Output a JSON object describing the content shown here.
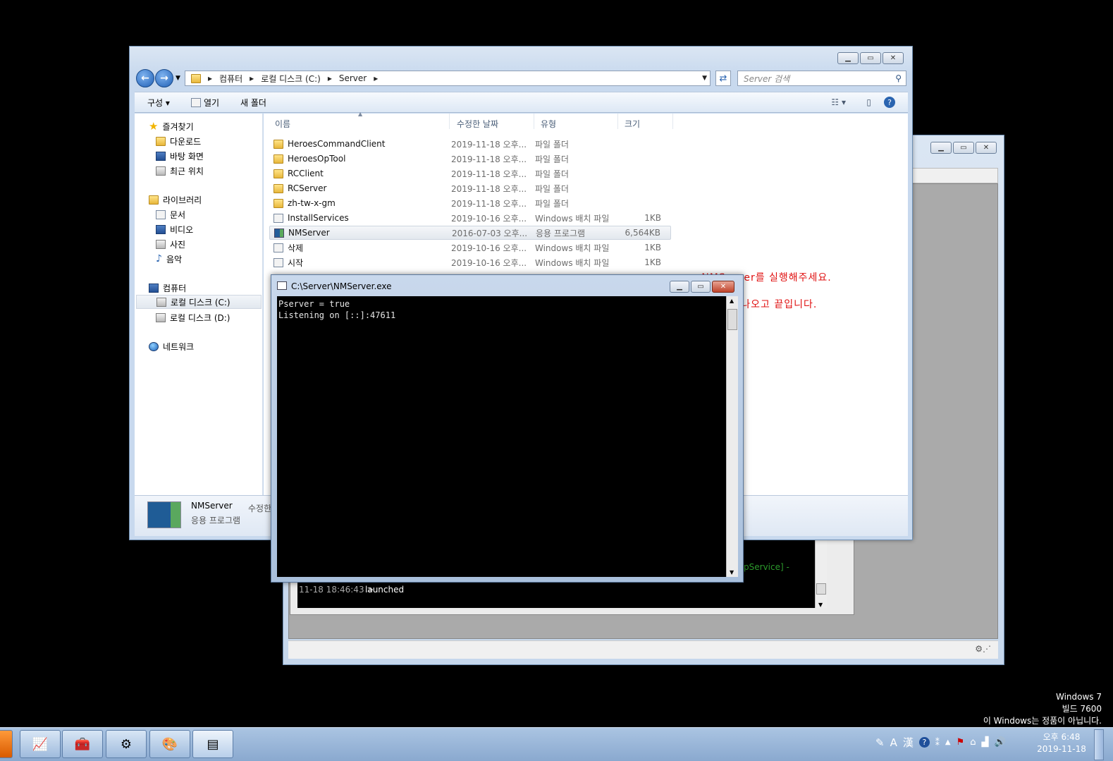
{
  "explorer": {
    "breadcrumb": [
      "컴퓨터",
      "로컬 디스크 (C:)",
      "Server"
    ],
    "search_placeholder": "Server 검색",
    "toolbar": {
      "organize": "구성",
      "open": "열기",
      "new_folder": "새 폴더"
    },
    "nav": {
      "favorites": "즐겨찾기",
      "downloads": "다운로드",
      "desktop": "바탕 화면",
      "recent": "최근 위치",
      "libraries": "라이브러리",
      "documents": "문서",
      "videos": "비디오",
      "pictures": "사진",
      "music": "음악",
      "computer": "컴퓨터",
      "drive_c": "로컬 디스크 (C:)",
      "drive_d": "로컬 디스크 (D:)",
      "network": "네트워크"
    },
    "columns": {
      "name": "이름",
      "date": "수정한 날짜",
      "type": "유형",
      "size": "크기"
    },
    "files": [
      {
        "name": "HeroesCommandClient",
        "date": "2019-11-18 오후...",
        "type": "파일 폴더",
        "size": ""
      },
      {
        "name": "HeroesOpTool",
        "date": "2019-11-18 오후...",
        "type": "파일 폴더",
        "size": ""
      },
      {
        "name": "RCClient",
        "date": "2019-11-18 오후...",
        "type": "파일 폴더",
        "size": ""
      },
      {
        "name": "RCServer",
        "date": "2019-11-18 오후...",
        "type": "파일 폴더",
        "size": ""
      },
      {
        "name": "zh-tw-x-gm",
        "date": "2019-11-18 오후...",
        "type": "파일 폴더",
        "size": ""
      },
      {
        "name": "InstallServices",
        "date": "2019-10-16 오후...",
        "type": "Windows 배치 파일",
        "size": "1KB"
      },
      {
        "name": "NMServer",
        "date": "2016-07-03 오후...",
        "type": "응용 프로그램",
        "size": "6,564KB"
      },
      {
        "name": "삭제",
        "date": "2019-10-16 오후...",
        "type": "Windows 배치 파일",
        "size": "1KB"
      },
      {
        "name": "시작",
        "date": "2019-10-16 오후...",
        "type": "Windows 배치 파일",
        "size": "1KB"
      }
    ],
    "details": {
      "name": "NMServer",
      "type": "응용 프로그램",
      "modified_label": "수정한"
    }
  },
  "notes": {
    "line1": "<- NMServer를 실행해주세요.",
    "line2": "도스창 하나 나오고 끝입니다."
  },
  "cmd": {
    "title": "C:\\Server\\NMServer.exe",
    "lines": [
      "Pserver = true",
      "Listening on [::]:47611"
    ]
  },
  "log_console": {
    "service_fragment": "pService] -",
    "timestamp": "11-18 18:46:43 >",
    "message": "launched"
  },
  "watermark": {
    "line1": "Windows 7",
    "line2": "빌드 7600",
    "line3": "이 Windows는 정품이 아닙니다."
  },
  "tray": {
    "lang_a": "A",
    "lang_han": "漢",
    "time": "오후 6:48",
    "date": "2019-11-18"
  },
  "colors": {
    "note_red": "#e01010",
    "log_green": "#2c9a2c"
  }
}
